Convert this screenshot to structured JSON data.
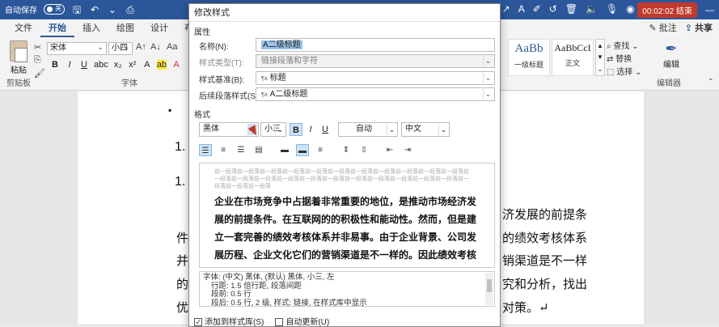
{
  "titlebar": {
    "autosave_label": "自动保存",
    "autosave_state": "关",
    "recording_time": "00:02:02",
    "recording_end": "结束",
    "minimize": "—"
  },
  "tabs": {
    "items": [
      "文件",
      "开始",
      "插入",
      "绘图",
      "设计",
      "布局"
    ],
    "active": "开始",
    "right": {
      "comment": "批注",
      "share": "共享"
    }
  },
  "ribbon": {
    "paste_label": "粘贴",
    "clipboard_label": "剪贴板",
    "font_group_label": "字体",
    "font_name": "宋体",
    "font_size": "小四",
    "bold": "B",
    "italic": "I",
    "underline": "U",
    "styles": [
      {
        "sample": "AaBb",
        "name": "一级标题"
      },
      {
        "sample": "AaBbCcI",
        "name": "正文"
      }
    ],
    "find": "查找",
    "replace": "替换",
    "select": "选择",
    "edit_label": "编辑",
    "editor_label": "编辑器"
  },
  "doc": {
    "bullet": "▪",
    "num1": "1.",
    "num2": "1.",
    "right_lines": [
      "济发展的前提条",
      "的绩效考核体系",
      "销渠道是不一样",
      "究和分析，找出",
      "对策。↵"
    ],
    "left_chars": [
      "件",
      "并",
      "的",
      "优"
    ]
  },
  "dialog": {
    "title": "修改样式",
    "section_props": "属性",
    "name_label": "名称(N):",
    "name_value": "A二级标题",
    "type_label": "样式类型(T):",
    "type_value": "链接段落和字符",
    "based_label": "样式基准(B):",
    "based_value": "标题",
    "next_label": "后续段落样式(S):",
    "next_value": "A二级标题",
    "section_format": "格式",
    "font_name": "黑体",
    "font_size": "小三",
    "bold": "B",
    "italic": "I",
    "underline": "U",
    "color": "自动",
    "lang": "中文",
    "preview_gray": "前一段落前一段落前一段落前一段落前一段落前一段落前一段落前一段落前一段落前一段落前一段落前一段落前一段落前一段落前一段落前一段落前一段落前一段落前一段落前一段落前一段落前一段落前一段落前一段落前一段落",
    "preview_text": "企业在市场竞争中占据着非常重要的地位，是推动市场经济发展的前提条件。在互联网的的积极性和能动性。然而，但是建立一套完善的绩效考核体系并非易事。由于企业背景、公司发展历程、企业文化它们的营销渠道是不一样的。因此绩效考核",
    "desc_lines": [
      "字体: (中文) 黑体, (默认) 黑体, 小三, 左",
      "行距: 1.5 倍行距, 段落间距",
      "段前: 0.5 行",
      "段后: 0.5 行, 2 级, 样式: 链接, 在样式库中显示"
    ],
    "check1": "添加到样式库(S)",
    "check2": "自动更新(U)"
  }
}
